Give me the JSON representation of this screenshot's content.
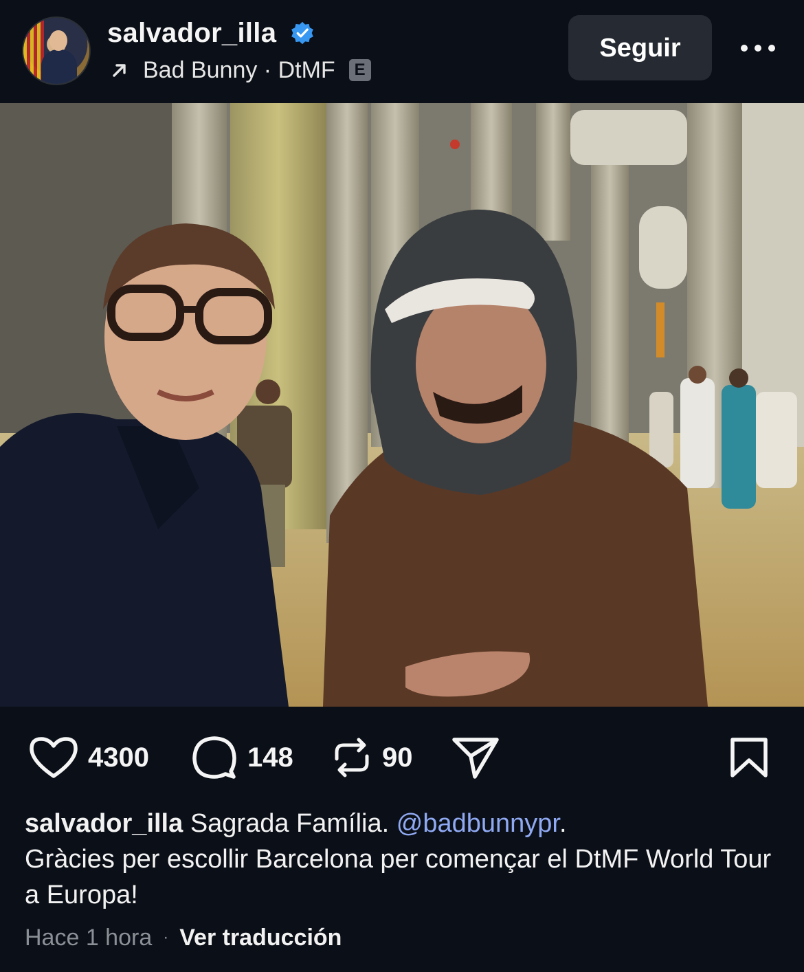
{
  "post": {
    "username": "salvador_illa",
    "verified_icon": "verified-badge-icon",
    "music": {
      "arrow_icon": "arrow-up-right-icon",
      "label": "Bad Bunny · DtMF",
      "explicit": "E"
    },
    "follow_label": "Seguir",
    "more_icon": "more-horizontal-icon"
  },
  "media": {
    "mute_icon": "speaker-muted-icon"
  },
  "actions": {
    "likes": "4300",
    "comments": "148",
    "reposts": "90",
    "share_icon": "send-icon",
    "bookmark_icon": "bookmark-icon"
  },
  "caption": {
    "username": "salvador_illa",
    "text_1": "Sagrada Família.",
    "mention": "@badbunnypr",
    "period": ".",
    "text_2": "Gràcies per escollir Barcelona per començar el DtMF World Tour a Europa!"
  },
  "meta": {
    "time": "Hace 1 hora",
    "separator": "·",
    "translate": "Ver traducción"
  },
  "colors": {
    "background": "#0b0f17",
    "verified": "#3897f0",
    "mention": "#8fa9f2",
    "button": "#262b33"
  }
}
